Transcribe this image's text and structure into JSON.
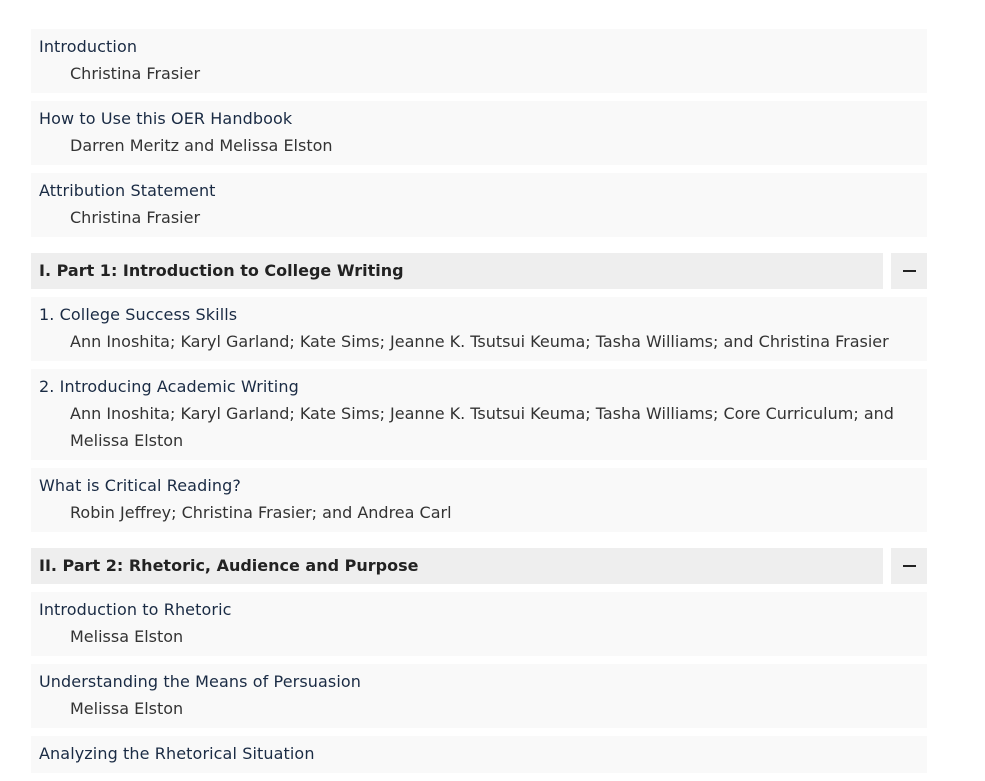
{
  "front_matter": [
    {
      "title": "Introduction",
      "authors": "Christina Frasier"
    },
    {
      "title": "How to Use this OER Handbook",
      "authors": "Darren Meritz and Melissa Elston"
    },
    {
      "title": "Attribution Statement",
      "authors": "Christina Frasier"
    }
  ],
  "parts": [
    {
      "title": "I. Part 1: Introduction to College Writing",
      "toggle_icon": "minus-icon",
      "chapters": [
        {
          "title": "1. College Success Skills",
          "authors": "Ann Inoshita; Karyl Garland; Kate Sims; Jeanne K. Tsutsui Keuma; Tasha Williams; and Christina Frasier"
        },
        {
          "title": "2. Introducing Academic Writing",
          "authors": "Ann Inoshita; Karyl Garland; Kate Sims; Jeanne K. Tsutsui Keuma; Tasha Williams; Core Curriculum; and Melissa Elston"
        },
        {
          "title": "What is Critical Reading?",
          "authors": "Robin Jeffrey; Christina Frasier; and Andrea Carl"
        }
      ]
    },
    {
      "title": "II. Part 2: Rhetoric, Audience and Purpose",
      "toggle_icon": "minus-icon",
      "chapters": [
        {
          "title": "Introduction to Rhetoric",
          "authors": "Melissa Elston"
        },
        {
          "title": "Understanding the Means of Persuasion",
          "authors": "Melissa Elston"
        },
        {
          "title": "Analyzing the Rhetorical Situation",
          "authors": ""
        }
      ]
    }
  ]
}
